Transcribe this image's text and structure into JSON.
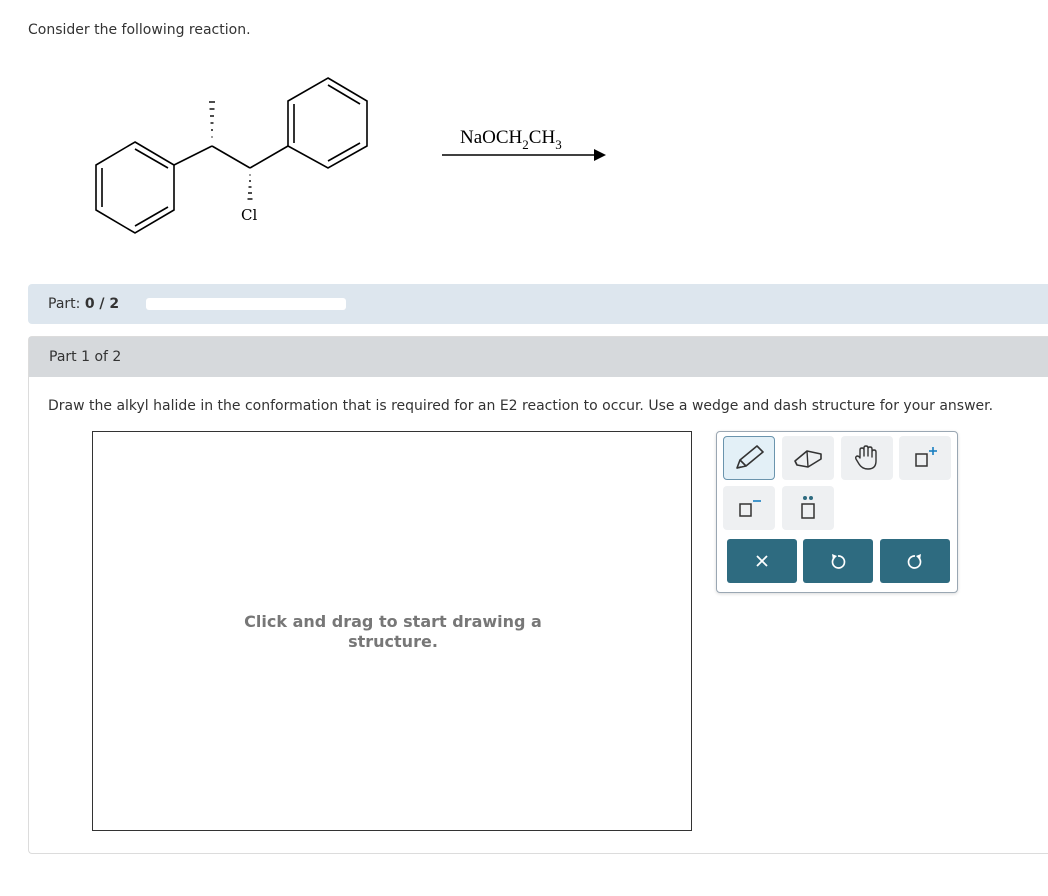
{
  "intro": "Consider the following reaction.",
  "reaction": {
    "reagent_main": "NaOCH",
    "reagent_sub1": "2",
    "reagent_mid": "CH",
    "reagent_sub2": "3",
    "halogen": "Cl"
  },
  "part_bar": {
    "prefix": "Part: ",
    "progress_text": "0 / 2",
    "progress_fraction": 0
  },
  "card": {
    "header": "Part 1 of 2",
    "question": "Draw the alkyl halide in the conformation that is required for an E2 reaction to occur. Use a wedge and dash structure for your answer.",
    "placeholder": "Click and drag to start drawing a structure."
  },
  "toolbar": {
    "tools": [
      "pencil-icon",
      "eraser-icon",
      "hand-icon",
      "positive-charge-icon",
      "negative-charge-icon",
      "lone-pair-icon"
    ],
    "actions": [
      "clear-icon",
      "undo-icon",
      "redo-icon"
    ],
    "accent": "#2e6b80",
    "charge_plus_color": "#1a7fc1"
  }
}
